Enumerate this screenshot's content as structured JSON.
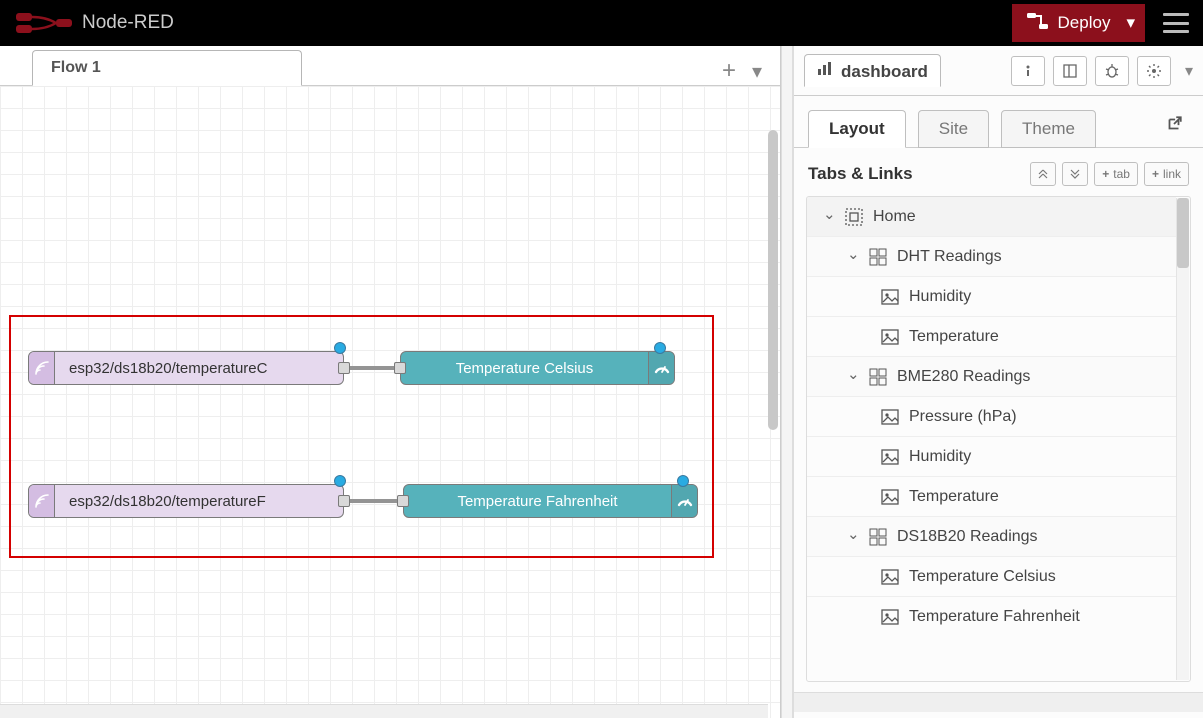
{
  "header": {
    "title": "Node-RED",
    "deploy_label": "Deploy"
  },
  "workspace": {
    "tabs": [
      {
        "label": "Flow 1"
      }
    ]
  },
  "nodes": {
    "mqtt_c": {
      "label": "esp32/ds18b20/temperatureC"
    },
    "gauge_c": {
      "label": "Temperature Celsius"
    },
    "mqtt_f": {
      "label": "esp32/ds18b20/temperatureF"
    },
    "gauge_f": {
      "label": "Temperature Fahrenheit"
    }
  },
  "sidebar": {
    "panel_label": "dashboard",
    "tabs": {
      "layout": "Layout",
      "site": "Site",
      "theme": "Theme"
    },
    "tabs_links_title": "Tabs & Links",
    "add_tab": "tab",
    "add_link": "link",
    "tree": {
      "home": "Home",
      "groups": [
        {
          "name": "DHT Readings",
          "items": [
            "Humidity",
            "Temperature"
          ]
        },
        {
          "name": "BME280 Readings",
          "items": [
            "Pressure (hPa)",
            "Humidity",
            "Temperature"
          ]
        },
        {
          "name": "DS18B20 Readings",
          "items": [
            "Temperature Celsius",
            "Temperature Fahrenheit"
          ]
        }
      ]
    }
  }
}
